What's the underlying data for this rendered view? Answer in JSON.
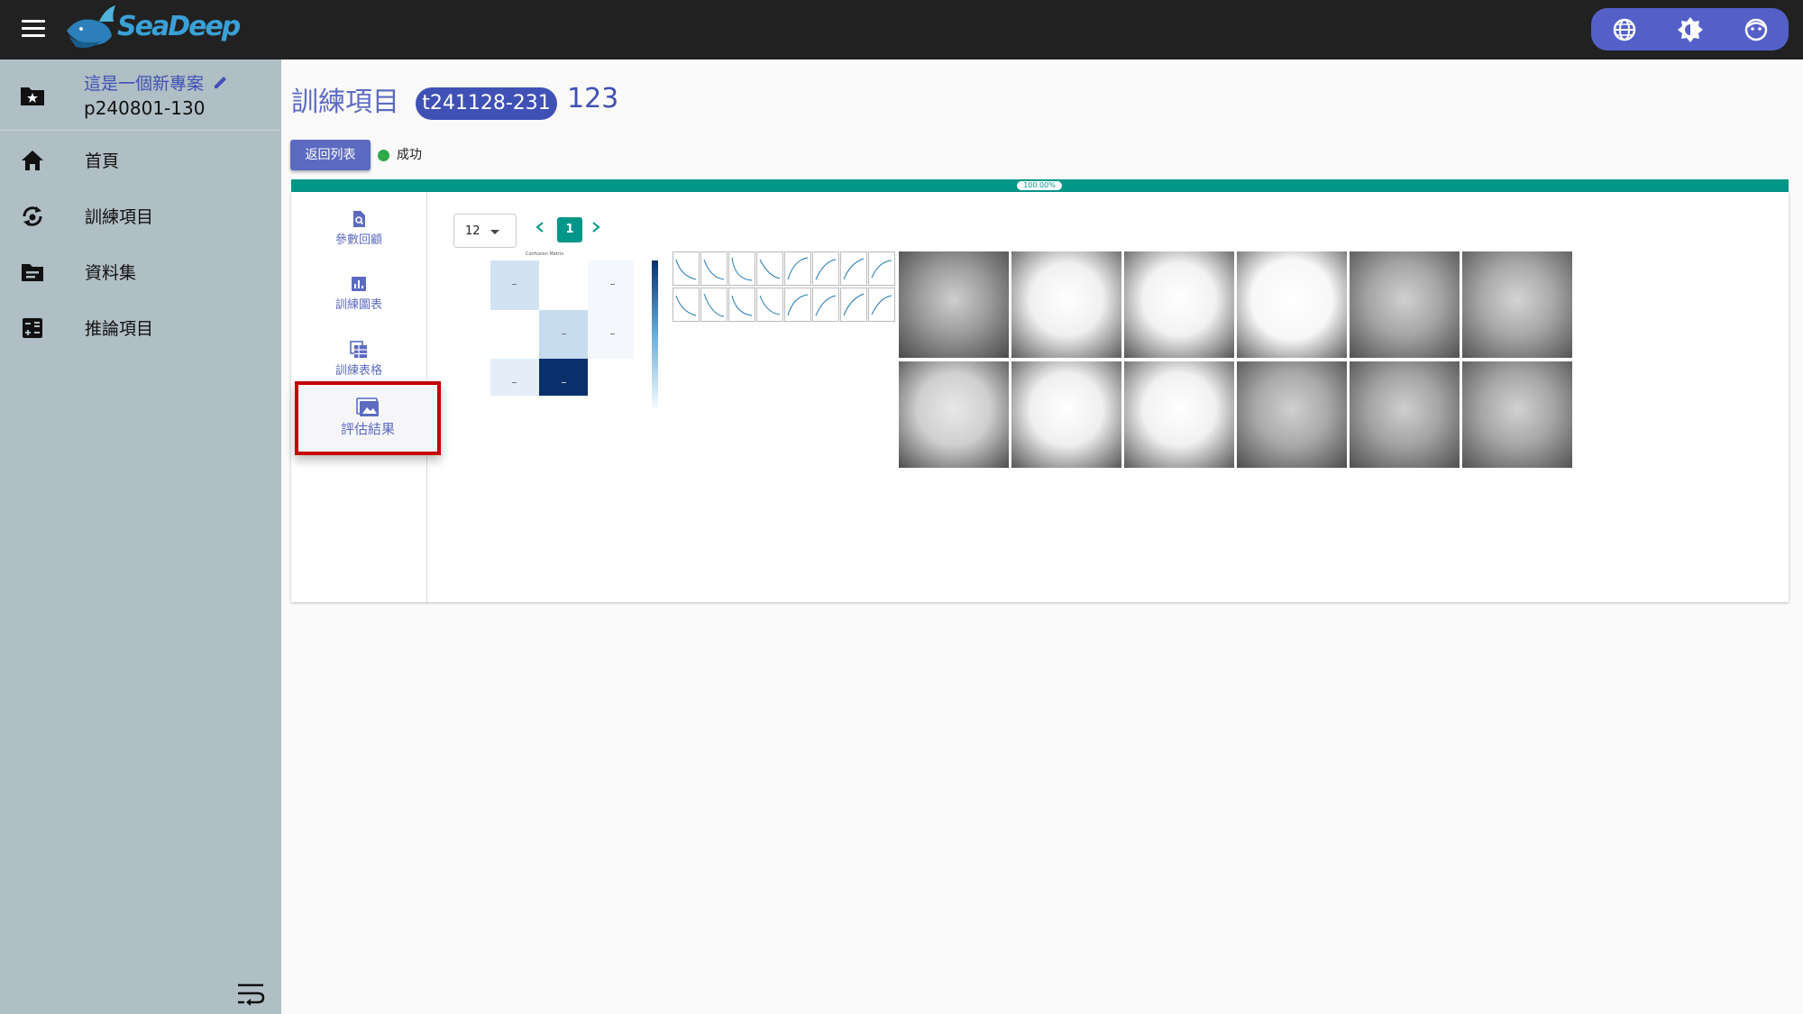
{
  "app": {
    "logo_text": "SeaDeep"
  },
  "sidebar": {
    "project": {
      "name": "這是一個新專案",
      "id": "p240801-130"
    },
    "items": [
      {
        "label": "首頁",
        "icon": "home-icon"
      },
      {
        "label": "訓練項目",
        "icon": "training-icon"
      },
      {
        "label": "資料集",
        "icon": "folder-icon"
      },
      {
        "label": "推論項目",
        "icon": "calculator-icon"
      }
    ]
  },
  "header": {
    "title": "訓練項目",
    "chip": "t241128-231",
    "name": "123"
  },
  "toolbar": {
    "back_label": "返回列表",
    "status": "成功"
  },
  "progress": {
    "label": "100.00%",
    "value": 100
  },
  "tabs": [
    {
      "label": "參數回顧",
      "icon": "document-search-icon"
    },
    {
      "label": "訓練圖表",
      "icon": "bar-chart-icon"
    },
    {
      "label": "訓練表格",
      "icon": "table-icon"
    },
    {
      "label": "評估結果",
      "icon": "image-gallery-icon",
      "active": true
    }
  ],
  "pager": {
    "page_size": "12",
    "current_page": "1"
  },
  "results": {
    "confusion_matrix_title": "Confusion Matrix"
  },
  "colors": {
    "topbar": "#212121",
    "accent": "#4051b5",
    "teal": "#009688",
    "highlight": "#c40000"
  }
}
